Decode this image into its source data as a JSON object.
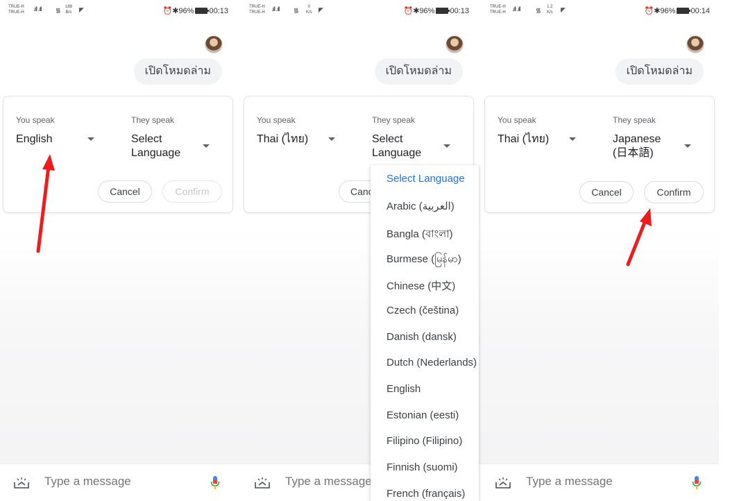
{
  "panels": [
    {
      "status": {
        "carrier_top": "TRUE-H",
        "carrier_bottom": "TRUE-H",
        "speed_top": "188",
        "speed_bottom": "B/s",
        "battery": "96%",
        "time": "00:13"
      },
      "user_message": "เปิดโหมดล่าม",
      "card": {
        "you_speak_label": "You speak",
        "you_speak_value": "English",
        "they_speak_label": "They speak",
        "they_speak_value": "Select\nLanguage",
        "cancel_label": "Cancel",
        "confirm_label": "Confirm",
        "confirm_enabled": false
      },
      "input_placeholder": "Type a message"
    },
    {
      "status": {
        "carrier_top": "TRUE-H",
        "carrier_bottom": "TRUE-H",
        "speed_top": "0",
        "speed_bottom": "K/s",
        "battery": "96%",
        "time": "00:13"
      },
      "user_message": "เปิดโหมดล่าม",
      "card": {
        "you_speak_label": "You speak",
        "you_speak_value": "Thai (ไทย)",
        "they_speak_label": "They speak",
        "they_speak_value": "Select\nLanguage",
        "cancel_label": "Canc",
        "confirm_label": "",
        "confirm_enabled": false
      },
      "input_placeholder": "Type a message"
    },
    {
      "status": {
        "carrier_top": "TRUE-H",
        "carrier_bottom": "TRUE-H",
        "speed_top": "1.2",
        "speed_bottom": "K/s",
        "battery": "96%",
        "time": "00:14"
      },
      "user_message": "เปิดโหมดล่าม",
      "card": {
        "you_speak_label": "You speak",
        "you_speak_value": "Thai (ไทย)",
        "they_speak_label": "They speak",
        "they_speak_value": "Japanese\n(日本語)",
        "cancel_label": "Cancel",
        "confirm_label": "Confirm",
        "confirm_enabled": true
      },
      "input_placeholder": "Type a message"
    }
  ],
  "language_dropdown": {
    "selected": "Select Language",
    "options": [
      "Select Language",
      "Arabic (العربية)",
      "Bangla (বাংলা)",
      "Burmese (မြန်မာ)",
      "Chinese (中文)",
      "Czech (čeština)",
      "Danish (dansk)",
      "Dutch (Nederlands)",
      "English",
      "Estonian (eesti)",
      "Filipino (Filipino)",
      "Finnish (suomi)",
      "French (français)"
    ]
  },
  "colors": {
    "accent_blue": "#1a73e8",
    "annotation_red": "#ee1c1c",
    "bubble_bg": "#f1f3f4"
  }
}
